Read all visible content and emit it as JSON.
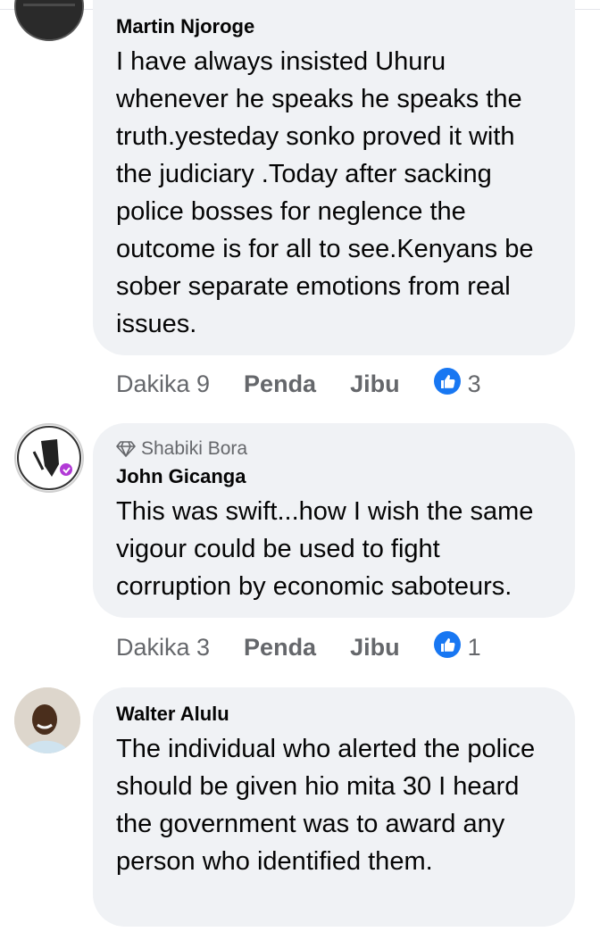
{
  "comments": [
    {
      "author": "Martin Njoroge",
      "badge": "",
      "text": "I have always insisted Uhuru whenever he speaks he speaks the truth.yesteday sonko proved it with the judiciary .Today after sacking police bosses for neglence the outcome is for all to see.Kenyans be sober separate emotions from real issues.",
      "time": "Dakika 9",
      "like_label": "Penda",
      "reply_label": "Jibu",
      "reaction_count": "3"
    },
    {
      "author": "John Gicanga",
      "badge": "Shabiki Bora",
      "text": "This was swift...how I wish the same vigour could be used to fight corruption by economic saboteurs.",
      "time": "Dakika 3",
      "like_label": "Penda",
      "reply_label": "Jibu",
      "reaction_count": "1"
    },
    {
      "author": "Walter Alulu",
      "badge": "",
      "text": "The individual who alerted the police should be given hio mita 30 I heard the government was to award any person who identified them.",
      "time": "",
      "like_label": "",
      "reply_label": "",
      "reaction_count": ""
    }
  ],
  "colors": {
    "bubble": "#f0f2f5",
    "meta_text": "#65676b",
    "like_blue": "#1877f2"
  },
  "icons": {
    "badge": "diamond-icon",
    "reaction": "thumbs-up-icon"
  }
}
